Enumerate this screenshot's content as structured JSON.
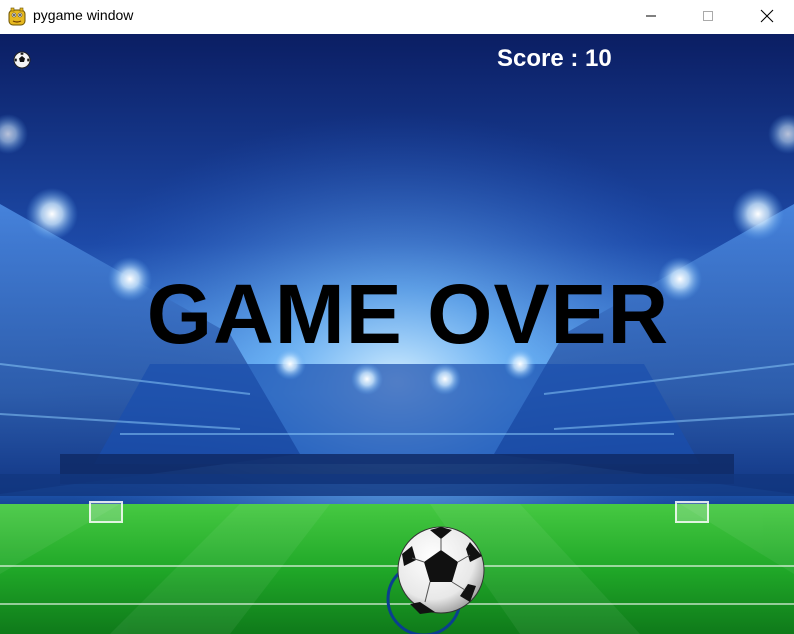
{
  "window": {
    "title": "pygame window",
    "icon": "pygame-snake-icon",
    "controls": {
      "minimize_icon": "minimize-icon",
      "maximize_icon": "maximize-icon",
      "close_icon": "close-icon"
    }
  },
  "game": {
    "score_text": "Score : 10",
    "status_text": "GAME OVER",
    "lives_icon": "soccer-ball-icon",
    "background": "stadium-pitch-image",
    "player_object": "soccer-ball",
    "colors": {
      "sky_top": "#0b1e63",
      "sky_glow": "#3d7fe0",
      "pitch_green": "#1fae2a",
      "score_color": "#ffffff",
      "status_color": "#000000",
      "ring_color": "#0a3f8f"
    }
  }
}
